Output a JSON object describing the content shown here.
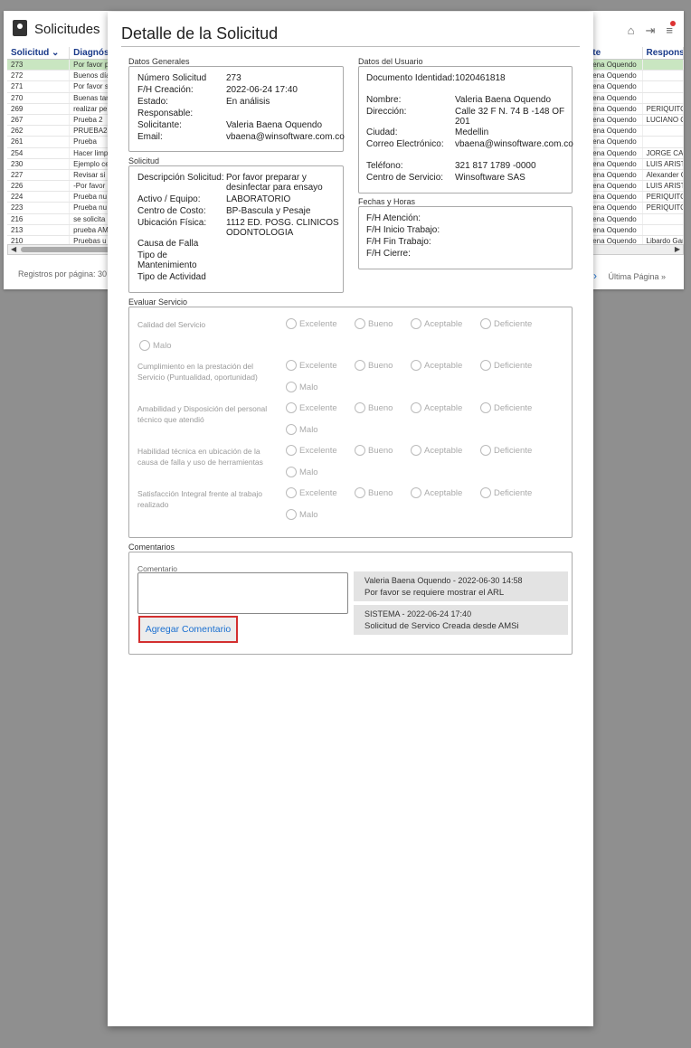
{
  "app": {
    "title": "Solicitudes",
    "columns": [
      "Solicitud ⌄",
      "Diagnóst",
      "te",
      "Responsa"
    ],
    "rows": [
      {
        "id": "273",
        "diag": "Por favor p",
        "user": "ena Oquendo",
        "resp": ""
      },
      {
        "id": "272",
        "diag": "Buenos día",
        "user": "ena Oquendo",
        "resp": ""
      },
      {
        "id": "271",
        "diag": "Por favor s",
        "user": "ena Oquendo",
        "resp": ""
      },
      {
        "id": "270",
        "diag": "Buenas tar",
        "user": "ena Oquendo",
        "resp": ""
      },
      {
        "id": "269",
        "diag": "realizar pe",
        "user": "ena Oquendo",
        "resp": "PERIQUITO"
      },
      {
        "id": "267",
        "diag": "Prueba 2",
        "user": "ena Oquendo",
        "resp": "LUCIANO Q"
      },
      {
        "id": "262",
        "diag": "PRUEBA23",
        "user": "ena Oquendo",
        "resp": ""
      },
      {
        "id": "261",
        "diag": "Prueba",
        "user": "ena Oquendo",
        "resp": ""
      },
      {
        "id": "254",
        "diag": "Hacer limp",
        "user": "ena Oquendo",
        "resp": "JORGE CAR"
      },
      {
        "id": "230",
        "diag": "Ejemplo ce",
        "user": "ena Oquendo",
        "resp": "LUIS ARIST"
      },
      {
        "id": "227",
        "diag": "Revisar si",
        "user": "ena Oquendo",
        "resp": "Alexander C"
      },
      {
        "id": "226",
        "diag": "-Por favor",
        "user": "ena Oquendo",
        "resp": "LUIS ARIST"
      },
      {
        "id": "224",
        "diag": "Prueba nu",
        "user": "ena Oquendo",
        "resp": "PERIQUITO"
      },
      {
        "id": "223",
        "diag": "Prueba nu",
        "user": "ena Oquendo",
        "resp": "PERIQUITO"
      },
      {
        "id": "216",
        "diag": "se solicita",
        "user": "ena Oquendo",
        "resp": ""
      },
      {
        "id": "213",
        "diag": "prueba AM",
        "user": "ena Oquendo",
        "resp": ""
      },
      {
        "id": "210",
        "diag": "Pruebas u",
        "user": "ena Oquendo",
        "resp": "Libardo Gar"
      }
    ],
    "footer_left": "Registros por página: 30",
    "footer_right": "Última Página »"
  },
  "modal": {
    "title": "Detalle de la Solicitud",
    "generales": {
      "label": "Datos Generales",
      "fields": [
        {
          "k": "Número Solicitud",
          "v": "273"
        },
        {
          "k": "F/H Creación:",
          "v": "2022-06-24 17:40"
        },
        {
          "k": "Estado:",
          "v": "En análisis"
        },
        {
          "k": "Responsable:",
          "v": ""
        },
        {
          "k": "Solicitante:",
          "v": "Valeria Baena Oquendo"
        },
        {
          "k": "Email:",
          "v": "vbaena@winsoftware.com.co"
        }
      ]
    },
    "solicitud": {
      "label": "Solicitud",
      "fields": [
        {
          "k": "Descripción Solicitud:",
          "v": "Por favor preparar y desinfectar para ensayo"
        },
        {
          "k": "Activo / Equipo:",
          "v": "LABORATORIO"
        },
        {
          "k": "Centro de Costo:",
          "v": "BP-Bascula y Pesaje"
        },
        {
          "k": "Ubicación Física:",
          "v": "1112 ED. POSG. CLINICOS ODONTOLOGIA"
        },
        {
          "k": "Causa de Falla",
          "v": ""
        },
        {
          "k": "Tipo de Mantenimiento",
          "v": ""
        },
        {
          "k": "Tipo de Actividad",
          "v": ""
        }
      ]
    },
    "usuario": {
      "label": "Datos del Usuario",
      "fields": [
        {
          "k": "Documento Identidad:",
          "v": "1020461818"
        },
        {
          "k": "Nombre:",
          "v": "Valeria Baena Oquendo"
        },
        {
          "k": "Dirección:",
          "v": "Calle 32 F N. 74 B -148 OF 201"
        },
        {
          "k": "Ciudad:",
          "v": "Medellin"
        },
        {
          "k": "Correo Electrónico:",
          "v": "vbaena@winsoftware.com.co"
        },
        {
          "k": "Teléfono:",
          "v": "321 817 1789 -0000"
        },
        {
          "k": "Centro de Servicio:",
          "v": "Winsoftware SAS"
        }
      ]
    },
    "fechas": {
      "label": "Fechas y Horas",
      "fields": [
        "F/H Atención:",
        "F/H Inicio Trabajo:",
        "F/H Fin Trabajo:",
        "F/H Cierre:"
      ]
    },
    "evaluar": {
      "label": "Evaluar Servicio",
      "options": [
        "Excelente",
        "Bueno",
        "Aceptable",
        "Deficiente",
        "Malo"
      ],
      "questions": [
        "Calidad del Servicio",
        "Cumplimiento en la prestación del Servicio (Puntualidad, oportunidad)",
        "Amabilidad y Disposición del personal técnico que atendió",
        "Habilidad técnica en ubicación de la causa de falla y uso de herramientas",
        "Satisfacción Integral frente al trabajo realizado"
      ]
    },
    "comentarios": {
      "label": "Comentarios",
      "input_label": "Comentario",
      "button": "Agregar Comentario",
      "items": [
        {
          "header": "Valeria Baena Oquendo - 2022-06-30 14:58",
          "text": "Por favor se requiere mostrar el ARL"
        },
        {
          "header": "SISTEMA - 2022-06-24 17:40",
          "text": "Solicitud de Servico Creada desde AMSi"
        }
      ]
    }
  }
}
